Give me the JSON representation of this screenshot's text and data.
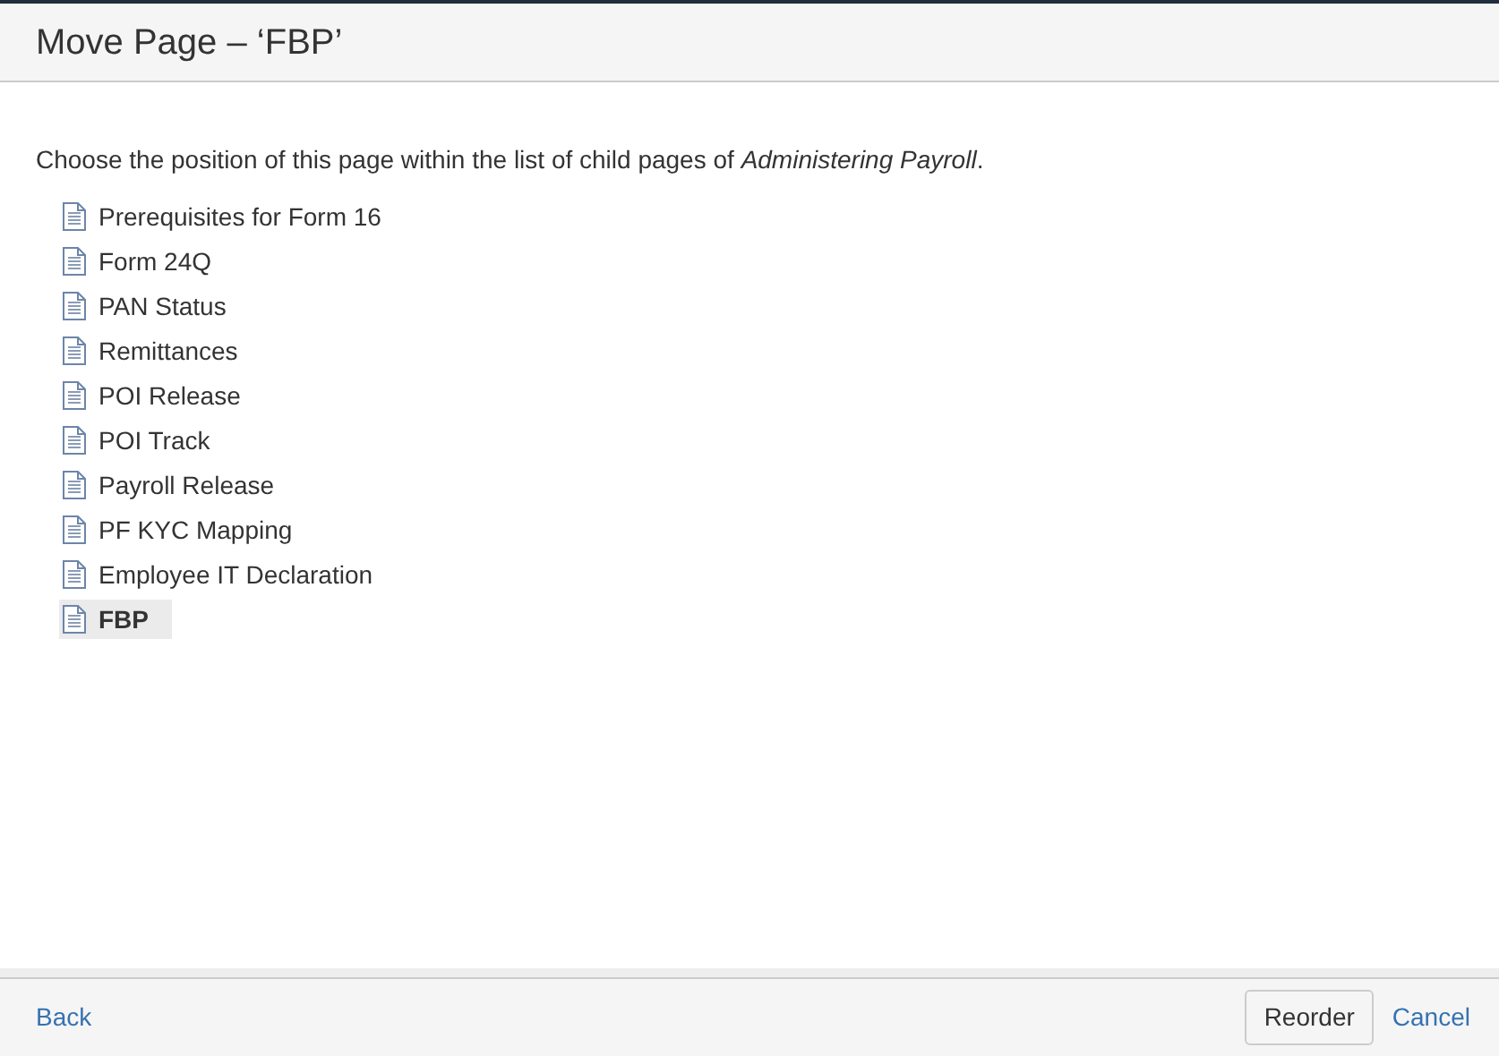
{
  "dialog": {
    "title": "Move Page – ‘FBP’",
    "instruction": "Choose the position of this page within the list of child pages of *Administering Payroll*.",
    "pages": [
      {
        "title": "Prerequisites for Form 16",
        "selected": false
      },
      {
        "title": "Form 24Q",
        "selected": false
      },
      {
        "title": "PAN Status",
        "selected": false
      },
      {
        "title": "Remittances",
        "selected": false
      },
      {
        "title": "POI Release",
        "selected": false
      },
      {
        "title": "POI Track",
        "selected": false
      },
      {
        "title": "Payroll Release",
        "selected": false
      },
      {
        "title": "PF KYC Mapping",
        "selected": false
      },
      {
        "title": "Employee IT Declaration",
        "selected": false
      },
      {
        "title": "FBP",
        "selected": true
      }
    ],
    "footer": {
      "back": "Back",
      "reorder": "Reorder",
      "cancel": "Cancel"
    }
  }
}
